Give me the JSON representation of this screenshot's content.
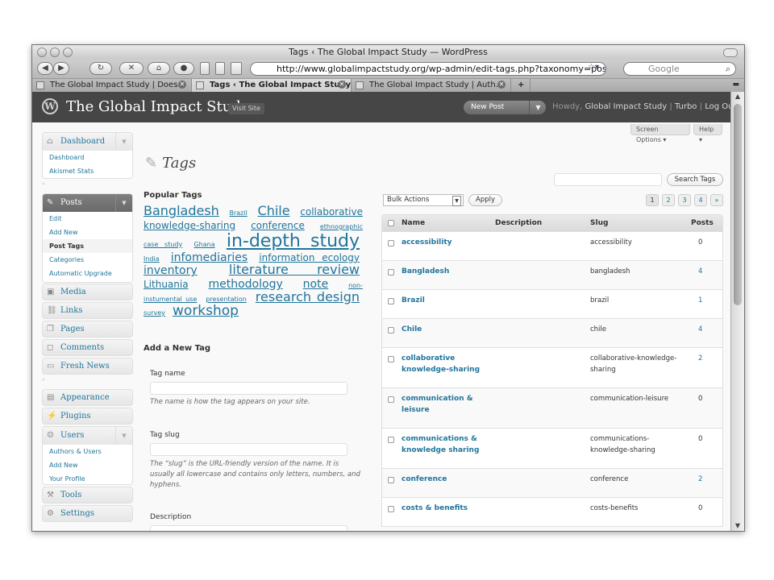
{
  "browser": {
    "window_title": "Tags ‹ The Global Impact Study — WordPress",
    "url": "http://www.globalimpactstudy.org/wp-admin/edit-tags.php?taxonomy=post_tag",
    "search_placeholder": "Google",
    "tabs": [
      {
        "label": "The Global Impact Study | Does…",
        "active": false
      },
      {
        "label": "Tags ‹ The Global Impact Study…",
        "active": true
      },
      {
        "label": "The Global Impact Study | Auth…",
        "active": false
      }
    ],
    "new_tab_label": "+"
  },
  "header": {
    "site_title": "The Global Impact Study",
    "visit_site": "Visit Site",
    "new_post": "New Post",
    "howdy_prefix": "Howdy,",
    "user": "Global Impact Study",
    "sep1": "|",
    "turbo": "Turbo",
    "sep2": "|",
    "logout": "Log Out"
  },
  "screen_options": "Screen Options",
  "help": "Help",
  "sidebar": {
    "dashboard": {
      "label": "Dashboard",
      "items": [
        "Dashboard",
        "Akismet Stats"
      ]
    },
    "posts": {
      "label": "Posts",
      "items": [
        "Edit",
        "Add New",
        "Post Tags",
        "Categories",
        "Automatic Upgrade"
      ]
    },
    "media": "Media",
    "links": "Links",
    "pages": "Pages",
    "comments": "Comments",
    "fresh_news": "Fresh News",
    "appearance": "Appearance",
    "plugins": "Plugins",
    "users": {
      "label": "Users",
      "items": [
        "Authors & Users",
        "Add New",
        "Your Profile"
      ]
    },
    "tools": "Tools",
    "settings": "Settings"
  },
  "page": {
    "title": "Tags",
    "popular_title": "Popular Tags",
    "add_new_title": "Add a New Tag",
    "tag_name_label": "Tag name",
    "tag_name_help": "The name is how the tag appears on your site.",
    "tag_slug_label": "Tag slug",
    "tag_slug_help": "The “slug” is the URL-friendly version of the name. It is usually all lowercase and contains only letters, numbers, and hyphens.",
    "description_label": "Description"
  },
  "tag_cloud": [
    {
      "text": "Bangladesh",
      "size": 16
    },
    {
      "text": "Brazil",
      "size": 8
    },
    {
      "text": "Chile",
      "size": 16
    },
    {
      "text": "collaborative knowledge-sharing",
      "size": 12
    },
    {
      "text": "conference",
      "size": 12
    },
    {
      "text": "ethnographic case study",
      "size": 8
    },
    {
      "text": "Ghana",
      "size": 8
    },
    {
      "text": "in-depth study",
      "size": 22
    },
    {
      "text": "India",
      "size": 8
    },
    {
      "text": "infomediaries",
      "size": 14
    },
    {
      "text": "information ecology",
      "size": 12
    },
    {
      "text": "inventory",
      "size": 14
    },
    {
      "text": "literature review",
      "size": 16
    },
    {
      "text": "Lithuania",
      "size": 12
    },
    {
      "text": "methodology",
      "size": 14
    },
    {
      "text": "note",
      "size": 14
    },
    {
      "text": "non-instumental use",
      "size": 8
    },
    {
      "text": "presentation",
      "size": 8
    },
    {
      "text": "research design",
      "size": 16
    },
    {
      "text": "survey",
      "size": 8
    },
    {
      "text": "workshop",
      "size": 17
    }
  ],
  "search_button": "Search Tags",
  "bulk_actions": "Bulk Actions",
  "apply": "Apply",
  "pagination": [
    "1",
    "2",
    "3",
    "4",
    "»"
  ],
  "table": {
    "columns": [
      "Name",
      "Description",
      "Slug",
      "Posts"
    ],
    "rows": [
      {
        "name": "accessibility",
        "slug": "accessibility",
        "posts": "0"
      },
      {
        "name": "Bangladesh",
        "slug": "bangladesh",
        "posts": "4"
      },
      {
        "name": "Brazil",
        "slug": "brazil",
        "posts": "1"
      },
      {
        "name": "Chile",
        "slug": "chile",
        "posts": "4"
      },
      {
        "name": "collaborative knowledge-sharing",
        "slug": "collaborative-knowledge-sharing",
        "posts": "2"
      },
      {
        "name": "communication & leisure",
        "slug": "communication-leisure",
        "posts": "0"
      },
      {
        "name": "communications & knowledge sharing",
        "slug": "communications-knowledge-sharing",
        "posts": "0"
      },
      {
        "name": "conference",
        "slug": "conference",
        "posts": "2"
      },
      {
        "name": "costs & benefits",
        "slug": "costs-benefits",
        "posts": "0"
      }
    ]
  }
}
